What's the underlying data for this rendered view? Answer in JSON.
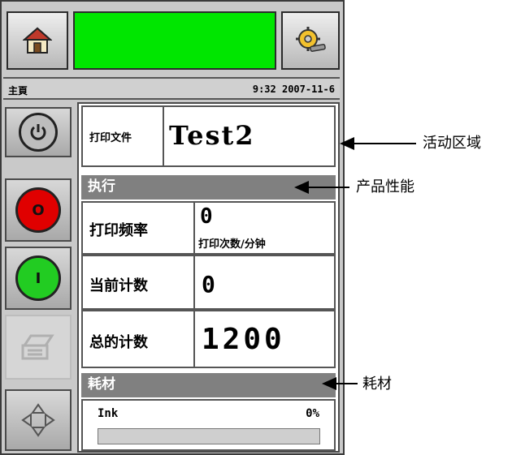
{
  "header": {
    "home_icon": "home-icon",
    "settings_icon": "settings-icon",
    "status_color": "#00e600"
  },
  "info": {
    "page_title": "主頁",
    "datetime": "9:32 2007-11-6"
  },
  "sidebar": {
    "power_icon": "power-icon",
    "stop_label": "O",
    "start_label": "I",
    "printer_icon": "printer-icon",
    "nav_icon": "arrows-icon"
  },
  "job": {
    "label": "打印文件",
    "name": "Test2"
  },
  "performance": {
    "title": "执行",
    "rows": [
      {
        "label": "打印频率",
        "value": "0",
        "unit": "打印次数/分钟"
      },
      {
        "label": "当前计数",
        "value": "0"
      },
      {
        "label": "总的计数",
        "value": "1200"
      }
    ]
  },
  "consumables": {
    "title": "耗材",
    "ink_label": "Ink",
    "ink_percent": "0%",
    "ink_level": 0
  },
  "callouts": {
    "active_area": "活动区域",
    "performance": "产品性能",
    "consumables": "耗材"
  },
  "colors": {
    "stop": "#e00000",
    "start": "#22cc22",
    "header_gray": "#808080"
  }
}
